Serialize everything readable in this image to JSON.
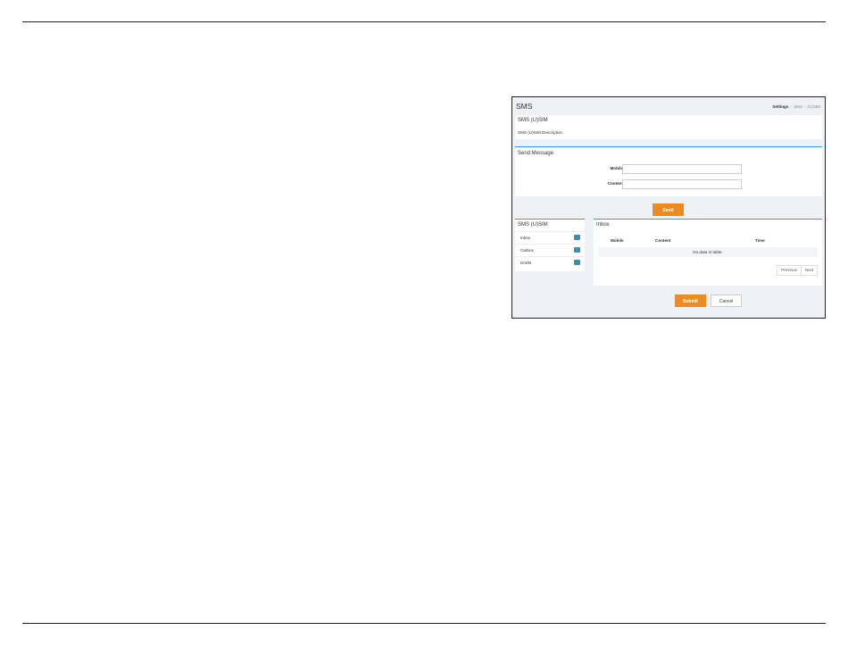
{
  "page": {
    "title": "SMS",
    "breadcrumb": [
      "Settings",
      "SMS",
      "(U)SIM"
    ]
  },
  "sim_panel": {
    "title": "SMS (U)SIM",
    "description": "SMS (U)SIM Description"
  },
  "send_panel": {
    "title": "Send Message",
    "mobile_label": "Mobile",
    "mobile_value": "",
    "content_label": "Content",
    "content_value": "",
    "send_button": "Send"
  },
  "menu_panel": {
    "title": "SMS (U)SIM",
    "items": [
      {
        "label": "Inbox"
      },
      {
        "label": "Outbox"
      },
      {
        "label": "Drafts"
      }
    ]
  },
  "inbox_panel": {
    "title": "Inbox",
    "columns": [
      "Mobile",
      "Content",
      "Time"
    ],
    "empty_text": "No data in table.",
    "previous": "Previous",
    "next": "Next"
  },
  "footer": {
    "submit": "Submit",
    "cancel": "Cancel"
  },
  "colors": {
    "accent": "#ec8b24",
    "panel_border": "#3c9ad6",
    "badge": "#3c8dbc",
    "background": "#eef1f5"
  }
}
